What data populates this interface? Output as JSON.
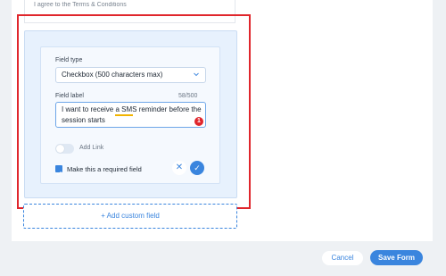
{
  "previous_field": {
    "text": "I agree to the Terms & Conditions"
  },
  "editor": {
    "field_type_label": "Field type",
    "field_type_value": "Checkbox (500 characters max)",
    "field_label_label": "Field label",
    "char_count": "58/500",
    "field_label_lines": [
      "I want to receive a SMS reminder before the",
      "session starts"
    ],
    "error_count": "1",
    "add_link_label": "Add Link",
    "add_link_enabled": false,
    "required_label": "Make this a required field",
    "required_checked": true
  },
  "add_custom_field_label": "+ Add custom field",
  "footer": {
    "cancel_label": "Cancel",
    "save_label": "Save Form"
  },
  "colors": {
    "accent": "#3a85de",
    "highlight": "#e0262c",
    "error": "#e0262c"
  }
}
